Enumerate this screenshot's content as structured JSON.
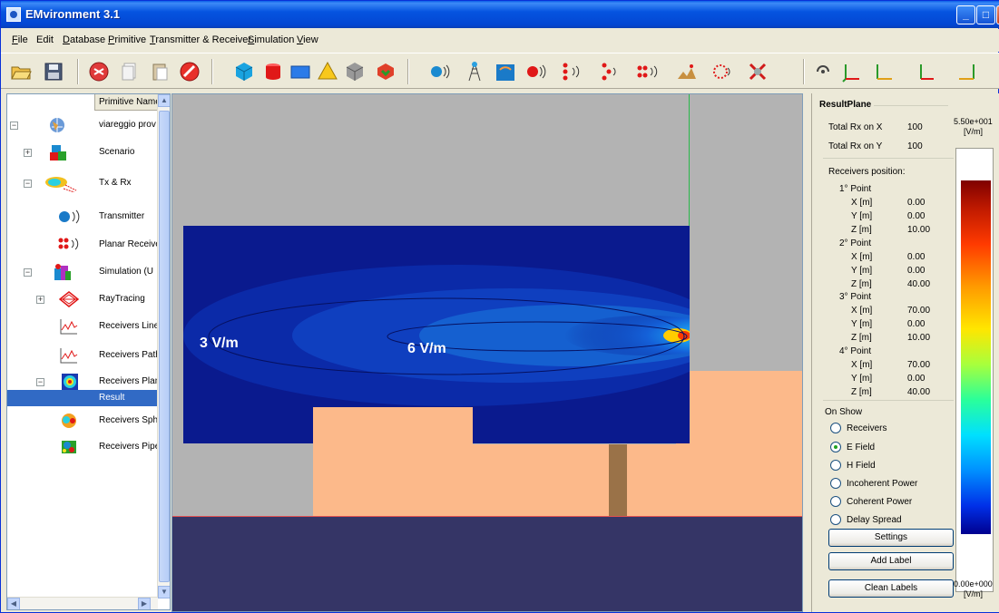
{
  "window": {
    "title": "EMvironment 3.1"
  },
  "menu": [
    {
      "label": "File",
      "u": "F",
      "rest": "ile"
    },
    {
      "label": "Edit",
      "u": "",
      "rest": "Edit"
    },
    {
      "label": "Database",
      "u": "D",
      "rest": "atabase"
    },
    {
      "label": "Primitive",
      "u": "P",
      "rest": "rimitive"
    },
    {
      "label": "Transmitter & Receiver",
      "u": "T",
      "rest": "ransmitter & Receiver"
    },
    {
      "label": "Simulation",
      "u": "S",
      "rest": "imulation"
    },
    {
      "label": "View",
      "u": "V",
      "rest": "iew"
    }
  ],
  "tree": {
    "column_header": "Primitive Name",
    "items": [
      {
        "label": "viareggio prov",
        "icon": "city-globe-icon"
      },
      {
        "label": "Scenario",
        "icon": "scenario-blocks-icon"
      },
      {
        "label": "Tx & Rx",
        "icon": "tx-rx-icon"
      },
      {
        "label": "Transmitter",
        "icon": "transmitter-icon"
      },
      {
        "label": "Planar Receivers",
        "icon": "planar-receivers-icon"
      },
      {
        "label": "Simulation (U",
        "icon": "simulation-icon"
      },
      {
        "label": "RayTracing",
        "icon": "raytracing-icon"
      },
      {
        "label": "Receivers Line",
        "icon": "receivers-line-icon"
      },
      {
        "label": "Receivers Path",
        "icon": "receivers-path-icon"
      },
      {
        "label": "Receivers Plane",
        "icon": "receivers-plane-icon"
      },
      {
        "label": "Result",
        "icon": ""
      },
      {
        "label": "Receivers Sphere",
        "icon": "receivers-sphere-icon"
      },
      {
        "label": "Receivers Pipe",
        "icon": "receivers-pipe-icon"
      }
    ]
  },
  "viewport": {
    "label_left": "3 V/m",
    "label_mid": "6 V/m"
  },
  "result_plane": {
    "title": "ResultPlane",
    "total_rx_x_label": "Total Rx on X",
    "total_rx_x": "100",
    "total_rx_y_label": "Total Rx on Y",
    "total_rx_y": "100",
    "receivers_position_label": "Receivers position:",
    "points": [
      {
        "name": "1° Point",
        "x": "0.00",
        "y": "0.00",
        "z": "10.00"
      },
      {
        "name": "2° Point",
        "x": "0.00",
        "y": "0.00",
        "z": "40.00"
      },
      {
        "name": "3° Point",
        "x": "70.00",
        "y": "0.00",
        "z": "10.00"
      },
      {
        "name": "4° Point",
        "x": "70.00",
        "y": "0.00",
        "z": "40.00"
      }
    ],
    "axis_x": "X [m]",
    "axis_y": "Y [m]",
    "axis_z": "Z [m]",
    "on_show_label": "On Show",
    "options": [
      "Receivers",
      "E Field",
      "H Field",
      "Incoherent Power",
      "Coherent Power",
      "Delay Spread"
    ],
    "selected_option": "E Field",
    "settings_button": "Settings",
    "add_label_button": "Add Label",
    "clean_labels_button": "Clean Labels",
    "colorbar_max": "5.50e+001",
    "colorbar_min": "0.00e+000",
    "colorbar_unit": "[V/m]"
  }
}
